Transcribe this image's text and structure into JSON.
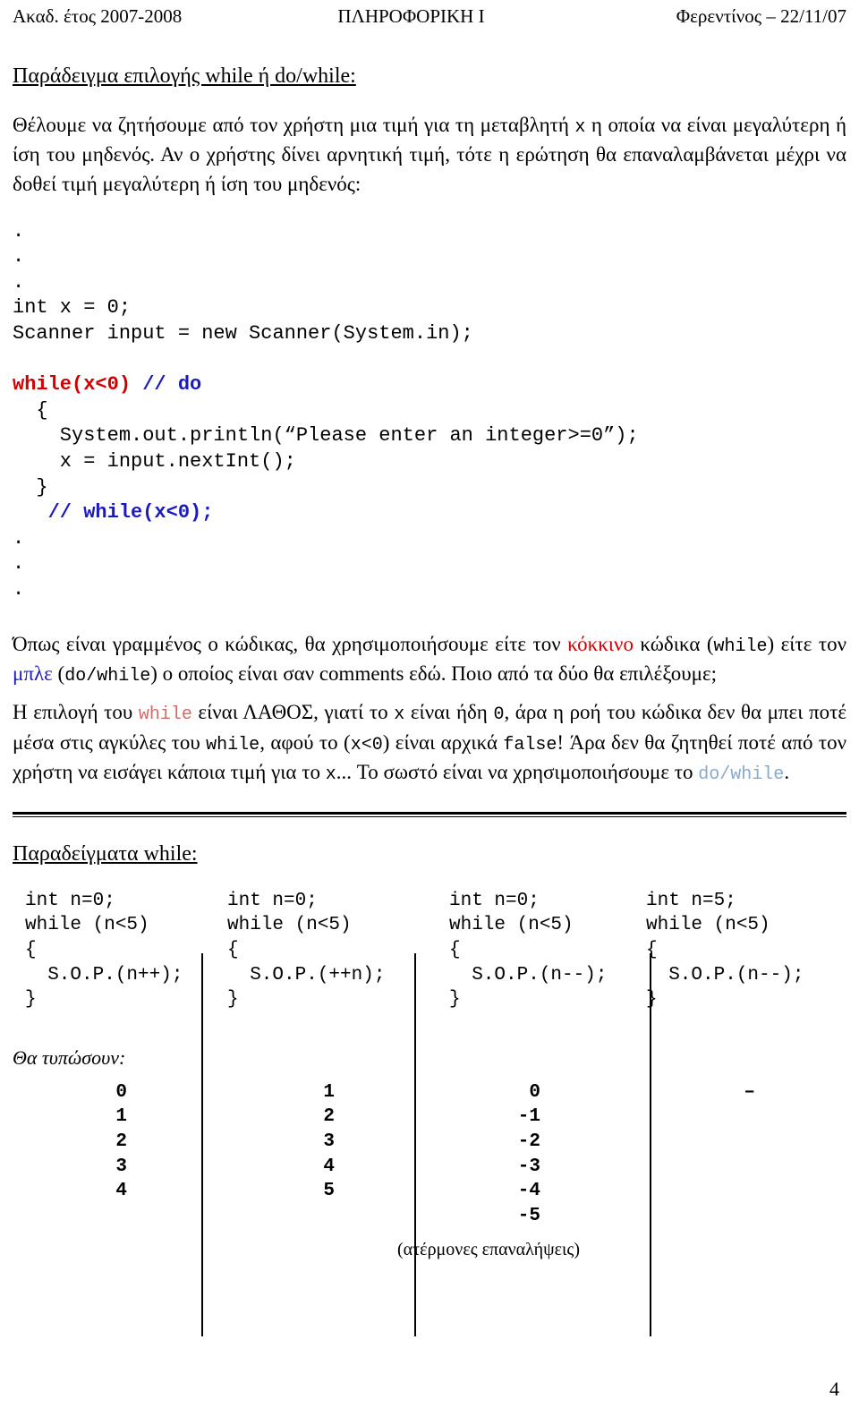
{
  "header": {
    "left": "Ακαδ. έτος 2007-2008",
    "center": "ΠΛΗΡΟΦΟΡΙΚΗ Ι",
    "right": "Φερεντίνος – 22/11/07"
  },
  "section1": {
    "title": "Παράδειγμα επιλογής while ή do/while:",
    "paragraph_part1": "Θέλουμε να ζητήσουμε από τον χρήστη μια τιμή για τη μεταβλητή ",
    "paragraph_var": "x",
    "paragraph_part2": " η οποία να είναι μεγαλύτερη ή ίση του μηδενός. Αν ο χρήστης δίνει αρνητική τιμή, τότε η ερώτηση θα επαναλαμβάνεται μέχρι να δοθεί τιμή μεγαλύτερη ή ίση του μηδενός:"
  },
  "code_block": {
    "dots_top": [
      ".",
      ".",
      "."
    ],
    "line_int_x": "int x = 0;",
    "line_scanner": "Scanner input = new Scanner(System.in);",
    "line_while_red": "while(x<0)",
    "line_while_blue_comment": "// do",
    "line_open_brace": "  {",
    "line_println": "    System.out.println(“Please enter an integer>=0”);",
    "line_nextint": "    x = input.nextInt();",
    "line_close_brace": "  }",
    "line_blue_while_comment": "   // while(x<0);",
    "dots_bottom": [
      ".",
      ".",
      "."
    ]
  },
  "explanation": {
    "p1_a": "Όπως είναι γραμμένος ο κώδικας, θα χρησιμοποιήσουμε είτε τον ",
    "p1_red": "κόκκινο",
    "p1_b": " κώδικα (",
    "p1_code_while": "while",
    "p1_c": ") είτε τον ",
    "p1_blue": "μπλε",
    "p1_d": " (",
    "p1_code_dowhile": "do/while",
    "p1_e": ") ο οποίος είναι σαν comments εδώ. Ποιο από τα δύο θα επιλέξουμε;",
    "p2_a": "Η επιλογή του ",
    "p2_code_while1": "while",
    "p2_b": " είναι ΛΑΘΟΣ, γιατί το ",
    "p2_code_x1": "x",
    "p2_c": " είναι ήδη ",
    "p2_code_zero": "0",
    "p2_d": ", άρα η ροή του κώδικα δεν θα μπει ποτέ μέσα στις αγκύλες του ",
    "p2_code_while2": "while",
    "p2_e": ", αφού το (",
    "p2_code_cond": "x<0",
    "p2_f": ") είναι αρχικά ",
    "p2_code_false": "false",
    "p2_g": "! Άρα δεν θα ζητηθεί ποτέ από τον χρήστη να εισάγει κάποια τιμή για το ",
    "p2_code_x2": "x",
    "p2_h": "... Το σωστό είναι να χρησιμοποιήσουμε το ",
    "p2_code_dowhile": "do/while",
    "p2_i": "."
  },
  "section2": {
    "title": "Παραδείγματα while:"
  },
  "examples": [
    {
      "name": "example-1",
      "lines": [
        "int n=0;",
        "while (n<5)",
        "{",
        "  S.O.P.(n++);",
        "}"
      ]
    },
    {
      "name": "example-2",
      "lines": [
        "int n=0;",
        "while (n<5)",
        "{",
        "  S.O.P.(++n);",
        "}"
      ]
    },
    {
      "name": "example-3",
      "lines": [
        "int n=0;",
        "while (n<5)",
        "{",
        "  S.O.P.(n--);",
        "}"
      ]
    },
    {
      "name": "example-4",
      "lines": [
        "int n=5;",
        "while (n<5)",
        "{",
        "  S.O.P.(n--);",
        "}"
      ]
    }
  ],
  "outputs": {
    "label": "Θα τυπώσουν:",
    "columns": [
      {
        "name": "output-1",
        "values": [
          "0",
          "1",
          "2",
          "3",
          "4"
        ]
      },
      {
        "name": "output-2",
        "values": [
          "1",
          "2",
          "3",
          "4",
          "5"
        ]
      },
      {
        "name": "output-3",
        "values": [
          "0",
          "-1",
          "-2",
          "-3",
          "-4",
          "-5"
        ]
      },
      {
        "name": "output-4",
        "values": [
          "–"
        ]
      }
    ],
    "note": "(ατέρμονες επαναλήψεις)"
  },
  "footer": {
    "page_number": "4"
  },
  "colors": {
    "red": "#d00000",
    "blue": "#1a1ac0",
    "light_blue": "#8aa8c8",
    "soft_red": "#d26a6a",
    "text": "#000000"
  }
}
